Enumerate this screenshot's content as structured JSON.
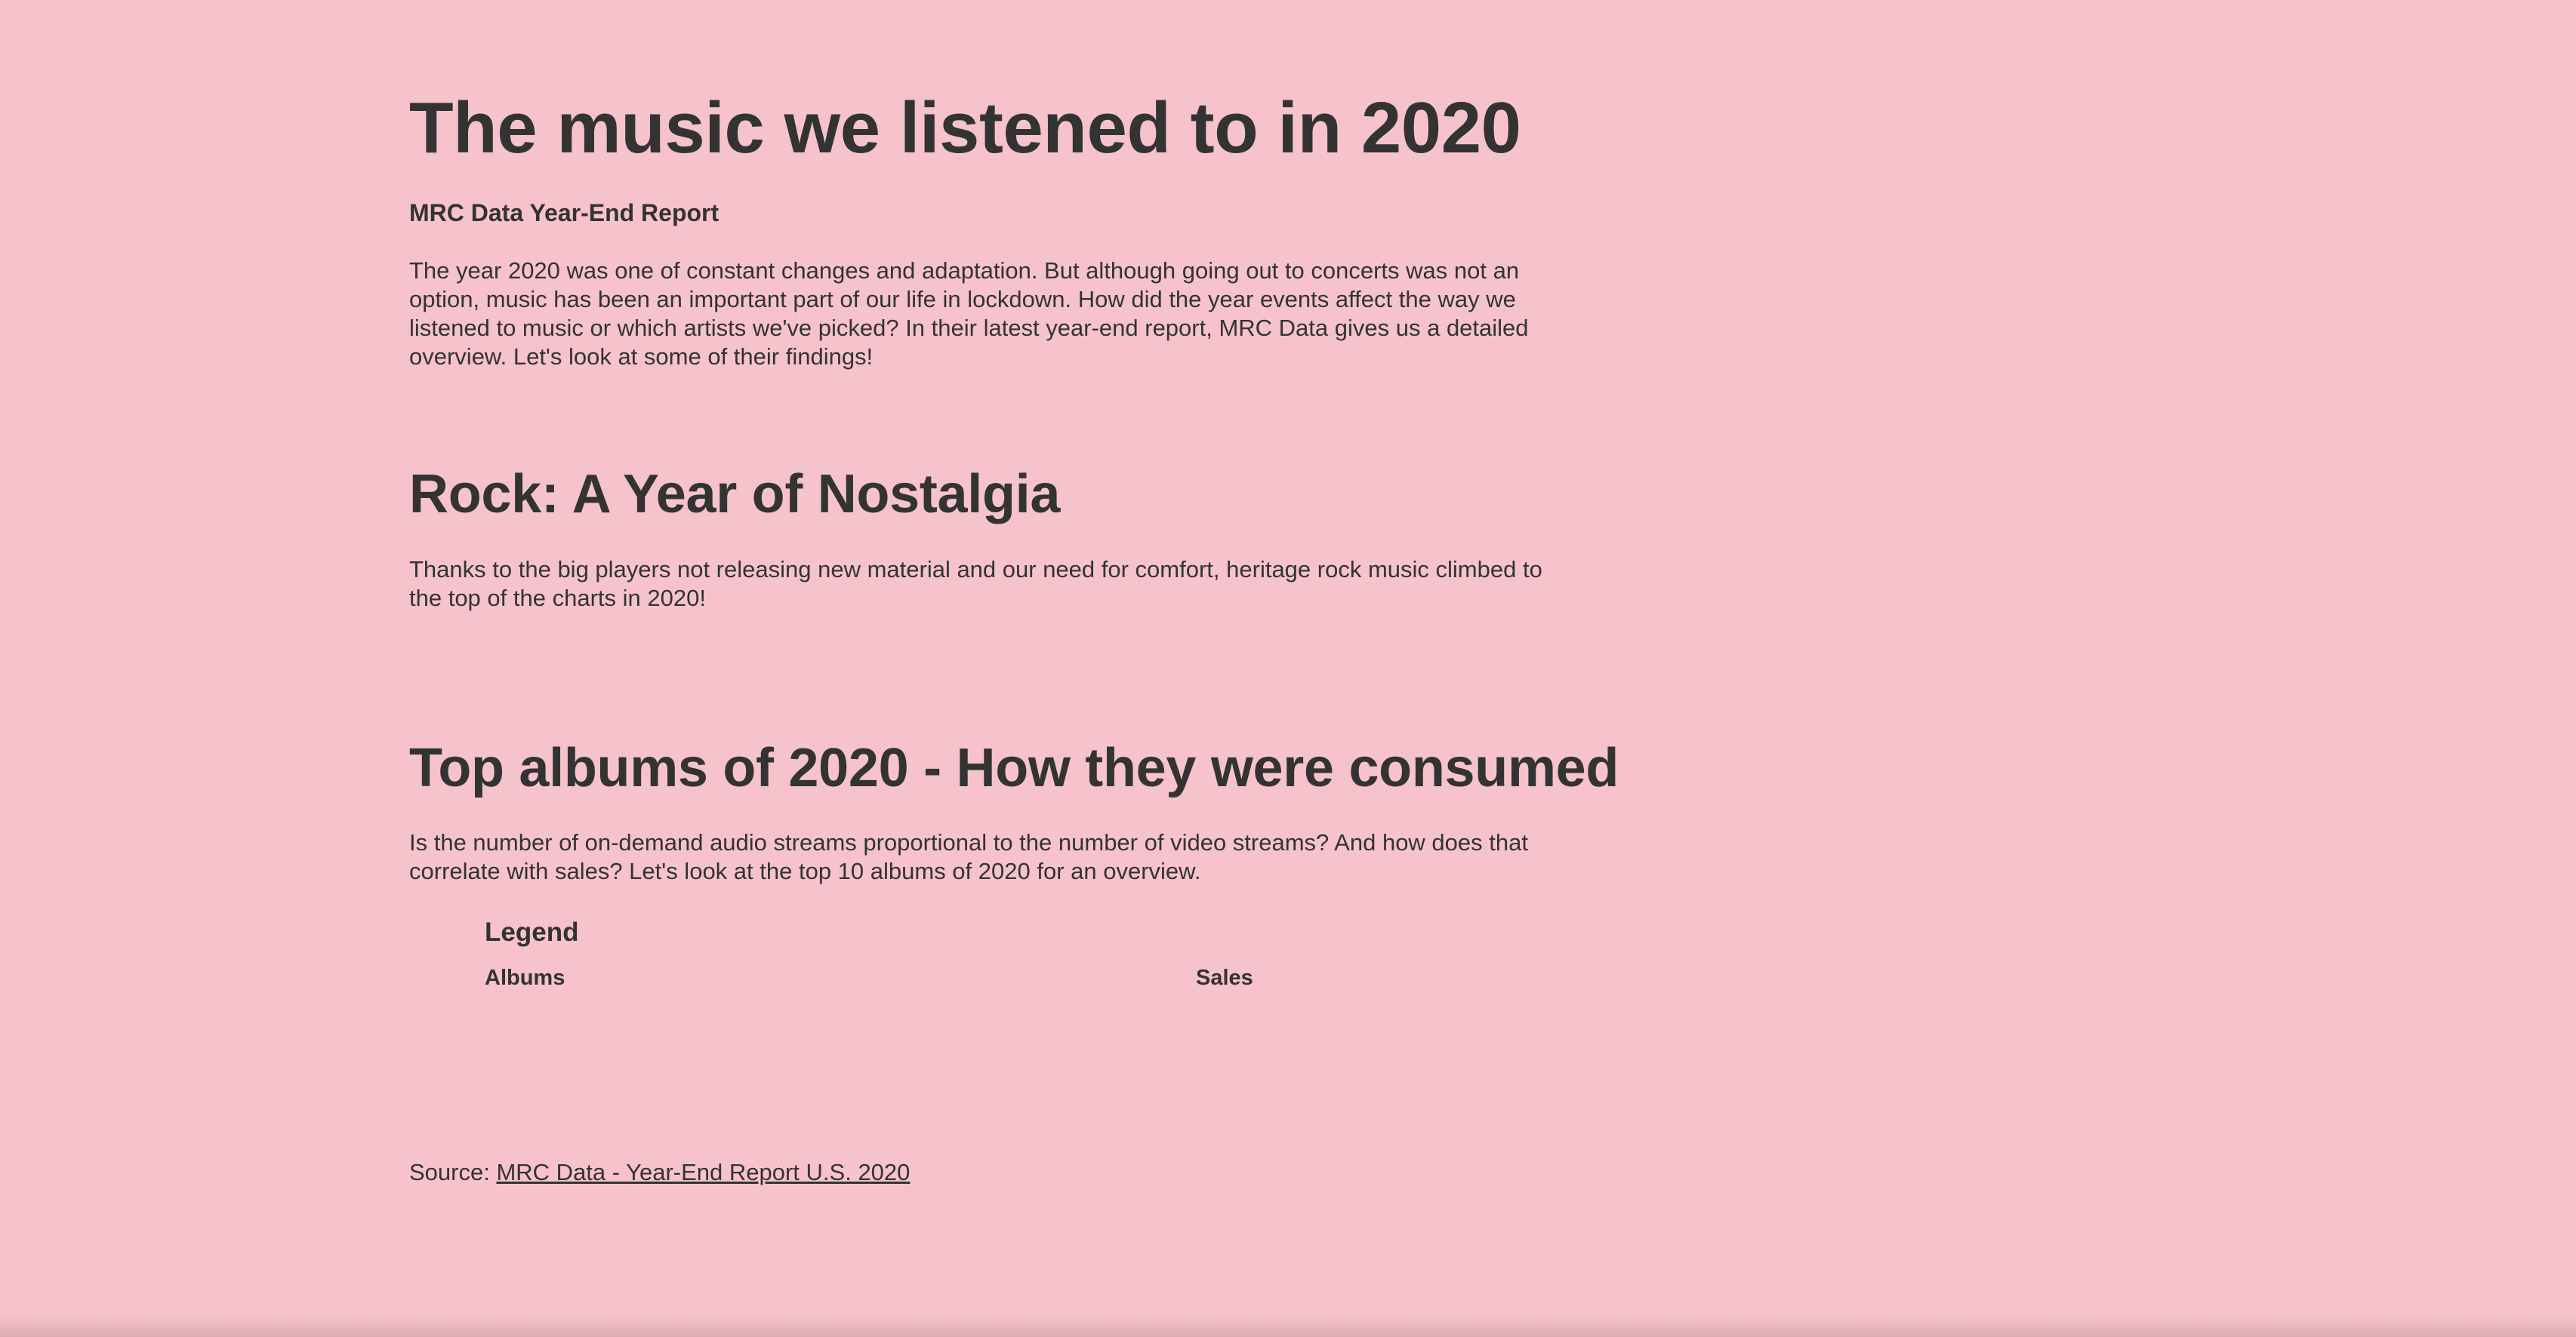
{
  "header": {
    "title": "The music we listened to in 2020",
    "subtitle": "MRC Data Year-End Report"
  },
  "intro": {
    "text": "The year 2020 was one of constant changes and adaptation. But although going out to concerts was not an option, music has been an important part of our life in lockdown. How did the year events affect the way we listened to music or which artists we've picked? In their latest year-end report, MRC Data gives us a detailed overview. Let's look at some of their findings!"
  },
  "rock_section": {
    "heading": "Rock: A Year of Nostalgia",
    "text": "Thanks to the big players not releasing new material and our need for comfort, heritage rock music climbed to the top of the charts in 2020!"
  },
  "albums_section": {
    "heading": "Top albums of 2020 - How they were consumed",
    "text": "Is the number of on-demand audio streams proportional to the number of video streams? And how does that correlate with sales? Let's look at the top 10 albums of 2020 for an overview.",
    "legend": {
      "title": "Legend",
      "albums_label": "Albums",
      "sales_label": "Sales"
    }
  },
  "source": {
    "prefix": "Source:",
    "link_text": "MRC Data - Year-End Report U.S. 2020"
  },
  "colors": {
    "background": "#f6c3cc",
    "text": "#333333"
  }
}
